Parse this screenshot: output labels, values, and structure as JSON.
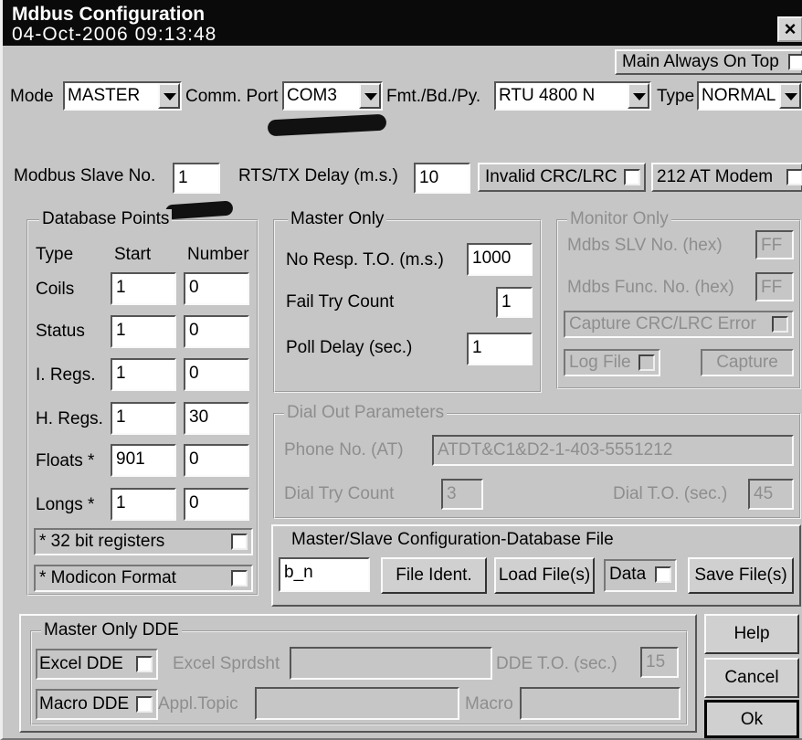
{
  "window": {
    "title": "Mdbus Configuration",
    "close_label": "×",
    "clock": "04-Oct-2006 09:13:48"
  },
  "main_always_on_top": {
    "label": "Main Always On Top",
    "checked": false
  },
  "top_row": {
    "mode_label": "Mode",
    "mode_value": "MASTER",
    "comm_port_label": "Comm. Port",
    "comm_port_value": "COM3",
    "fmt_label": "Fmt./Bd./Py.",
    "fmt_value": "RTU   4800 N",
    "type_label": "Type",
    "type_value": "NORMAL"
  },
  "slave_row": {
    "slave_no_label": "Modbus Slave No.",
    "slave_no_value": "1",
    "rts_label": "RTS/TX Delay (m.s.)",
    "rts_value": "10",
    "invalid_crc_label": "Invalid CRC/LRC",
    "modem_label": "212 AT Modem"
  },
  "database_points": {
    "title": "Database Points",
    "headers": [
      "Type",
      "Start",
      "Number"
    ],
    "rows": [
      {
        "type": "Coils",
        "start": "1",
        "number": "0"
      },
      {
        "type": "Status",
        "start": "1",
        "number": "0"
      },
      {
        "type": "I. Regs.",
        "start": "1",
        "number": "0"
      },
      {
        "type": "H. Regs.",
        "start": "1",
        "number": "30"
      },
      {
        "type": "Floats *",
        "start": "901",
        "number": "0"
      },
      {
        "type": "Longs *",
        "start": "1",
        "number": "0"
      }
    ],
    "bit32_label": "* 32 bit registers",
    "modicon_label": "* Modicon Format"
  },
  "master_only": {
    "title": "Master Only",
    "no_resp_label": "No Resp. T.O. (m.s.)",
    "no_resp_value": "1000",
    "fail_try_label": "Fail Try Count",
    "fail_try_value": "1",
    "poll_delay_label": "Poll Delay (sec.)",
    "poll_delay_value": "1"
  },
  "monitor_only": {
    "title": "Monitor Only",
    "slv_label": "Mdbs SLV No. (hex)",
    "slv_value": "FF",
    "func_label": "Mdbs Func. No. (hex)",
    "func_value": "FF",
    "capture_crc_label": "Capture CRC/LRC Error",
    "log_file_label": "Log File",
    "capture_button": "Capture"
  },
  "dial_out": {
    "title": "Dial Out Parameters",
    "phone_label": "Phone No. (AT)",
    "phone_value": "ATDT&C1&D2-1-403-5551212",
    "try_label": "Dial Try Count",
    "try_value": "3",
    "to_label": "Dial T.O. (sec.)",
    "to_value": "45"
  },
  "db_file": {
    "title": "Master/Slave Configuration-Database File",
    "file_value": "b_n",
    "file_ident": "File Ident.",
    "load_file": "Load File(s)",
    "data_label": "Data",
    "save_file": "Save File(s)"
  },
  "dde": {
    "title": "Master Only DDE",
    "excel_label": "Excel DDE",
    "sprdsht_label": "Excel Sprdsht",
    "dde_to_label": "DDE T.O. (sec.)",
    "dde_to_value": "15",
    "macro_dde_label": "Macro DDE",
    "appl_topic_label": "Appl.Topic",
    "macro_label": "Macro"
  },
  "buttons": {
    "help": "Help",
    "cancel": "Cancel",
    "ok": "Ok"
  }
}
